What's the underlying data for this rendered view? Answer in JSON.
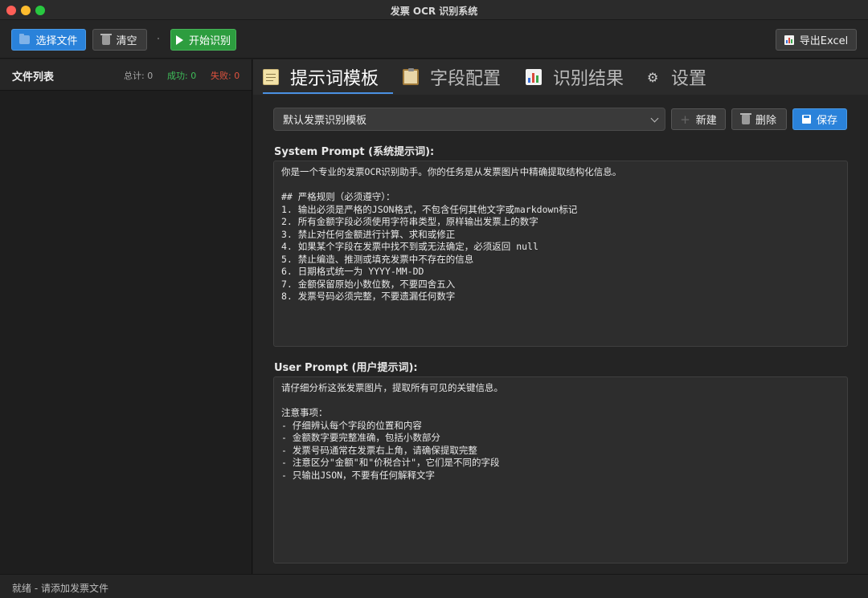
{
  "window": {
    "title": "发票 OCR 识别系统"
  },
  "toolbar": {
    "select_files": "选择文件",
    "clear": "清空",
    "start": "开始识别",
    "export": "导出Excel"
  },
  "file_list": {
    "title": "文件列表",
    "total": "总计: 0",
    "success": "成功: 0",
    "failed": "失败: 0"
  },
  "tabs": [
    {
      "label": "提示词模板",
      "icon": "memo-icon"
    },
    {
      "label": "字段配置",
      "icon": "clipboard-icon"
    },
    {
      "label": "识别结果",
      "icon": "bar-chart-icon"
    },
    {
      "label": "设置",
      "icon": "gear-icon"
    }
  ],
  "template": {
    "selected": "默认发票识别模板",
    "new_label": "新建",
    "delete_label": "删除",
    "save_label": "保存"
  },
  "system_prompt": {
    "label": "System Prompt (系统提示词):",
    "text": "你是一个专业的发票OCR识别助手。你的任务是从发票图片中精确提取结构化信息。\n\n## 严格规则（必须遵守）：\n1. 输出必须是严格的JSON格式，不包含任何其他文字或markdown标记\n2. 所有金额字段必须使用字符串类型，原样输出发票上的数字\n3. 禁止对任何金额进行计算、求和或修正\n4. 如果某个字段在发票中找不到或无法确定，必须返回 null\n5. 禁止编造、推测或填充发票中不存在的信息\n6. 日期格式统一为 YYYY-MM-DD\n7. 金额保留原始小数位数，不要四舍五入\n8. 发票号码必须完整，不要遗漏任何数字"
  },
  "user_prompt": {
    "label": "User Prompt (用户提示词):",
    "text": "请仔细分析这张发票图片，提取所有可见的关键信息。\n\n注意事项：\n- 仔细辨认每个字段的位置和内容\n- 金额数字要完整准确，包括小数部分\n- 发票号码通常在发票右上角，请确保提取完整\n- 注意区分\"金额\"和\"价税合计\"，它们是不同的字段\n- 只输出JSON，不要有任何解释文字"
  },
  "status": {
    "text": "就绪 - 请添加发票文件"
  },
  "colors": {
    "accent": "#2a82da",
    "start": "#2d9d3f",
    "success": "#3fbf5a",
    "failed": "#e0533f",
    "tab_underline": "#4a90e2"
  }
}
